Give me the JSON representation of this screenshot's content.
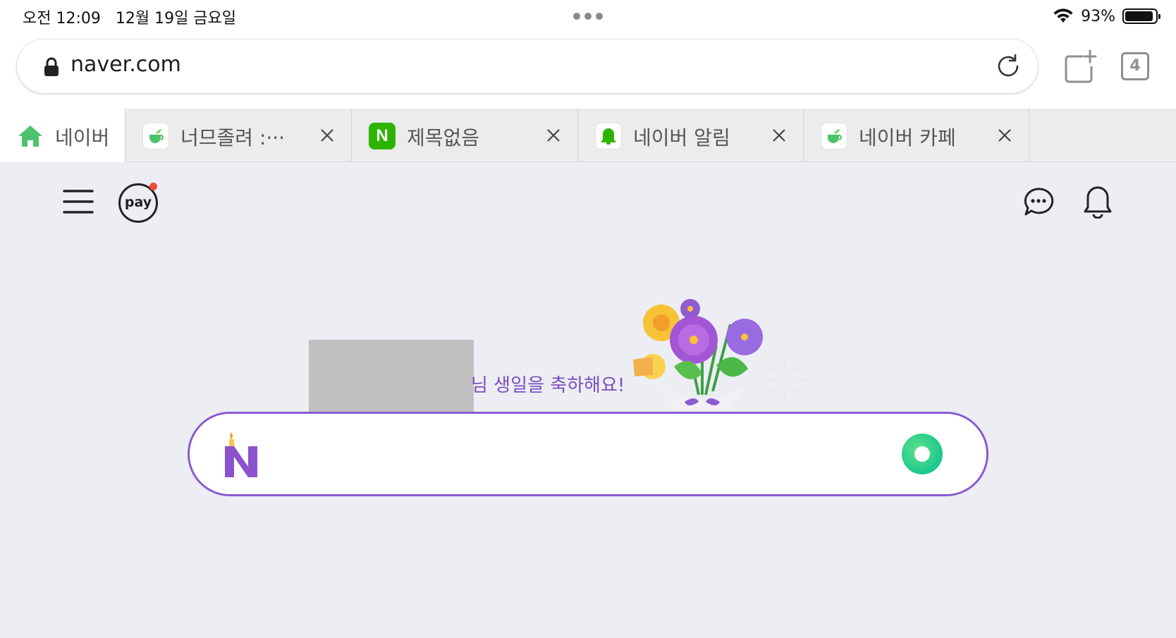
{
  "status_bar": {
    "time_date": "오전 12:09   12월 19일 금요일",
    "battery_percent": "93%",
    "battery_level": 0.93
  },
  "address_bar": {
    "url": "naver.com"
  },
  "toolbar": {
    "tab_count": "4"
  },
  "tabs": [
    {
      "title": "네이버",
      "active": true,
      "favicon": "house-icon"
    },
    {
      "title": "너므졸려 :···",
      "active": false,
      "favicon": "green-cup-icon"
    },
    {
      "title": "제목없음",
      "active": false,
      "favicon": "naver-n-icon"
    },
    {
      "title": "네이버 알림",
      "active": false,
      "favicon": "bell-icon"
    },
    {
      "title": "네이버 카페",
      "active": false,
      "favicon": "green-cup-icon"
    }
  ],
  "header": {
    "pay_label": "pay"
  },
  "doodle": {
    "message": "님 생일을 축하해요!"
  },
  "search": {
    "logo_letter": "N"
  },
  "colors": {
    "accent_purple": "#8a5ccf",
    "naver_green": "#2db400",
    "search_lens": "#19c98d"
  }
}
